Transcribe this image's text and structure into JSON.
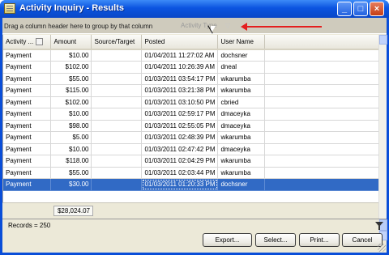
{
  "window": {
    "title": "Activity Inquiry - Results"
  },
  "group_panel": {
    "hint": "Drag a column header here to group by that column",
    "drag_ghost": "Activity Type"
  },
  "grid": {
    "columns": [
      "Activity ...",
      "Amount",
      "Source/Target",
      "Posted",
      "User Name"
    ],
    "rows": [
      {
        "activity": "Payment",
        "amount": "$10.00",
        "source": "",
        "posted": "01/04/2011 11:27:02 AM",
        "user": "dochsner"
      },
      {
        "activity": "Payment",
        "amount": "$102.00",
        "source": "",
        "posted": "01/04/2011 10:26:39 AM",
        "user": "dneal"
      },
      {
        "activity": "Payment",
        "amount": "$55.00",
        "source": "",
        "posted": "01/03/2011 03:54:17 PM",
        "user": "wkarumba"
      },
      {
        "activity": "Payment",
        "amount": "$115.00",
        "source": "",
        "posted": "01/03/2011 03:21:38 PM",
        "user": "wkarumba"
      },
      {
        "activity": "Payment",
        "amount": "$102.00",
        "source": "",
        "posted": "01/03/2011 03:10:50 PM",
        "user": "cbried"
      },
      {
        "activity": "Payment",
        "amount": "$10.00",
        "source": "",
        "posted": "01/03/2011 02:59:17 PM",
        "user": "dmaceyka"
      },
      {
        "activity": "Payment",
        "amount": "$98.00",
        "source": "",
        "posted": "01/03/2011 02:55:05 PM",
        "user": "dmaceyka"
      },
      {
        "activity": "Payment",
        "amount": "$5.00",
        "source": "",
        "posted": "01/03/2011 02:48:39 PM",
        "user": "wkarumba"
      },
      {
        "activity": "Payment",
        "amount": "$10.00",
        "source": "",
        "posted": "01/03/2011 02:47:42 PM",
        "user": "dmaceyka"
      },
      {
        "activity": "Payment",
        "amount": "$118.00",
        "source": "",
        "posted": "01/03/2011 02:04:29 PM",
        "user": "wkarumba"
      },
      {
        "activity": "Payment",
        "amount": "$55.00",
        "source": "",
        "posted": "01/03/2011 02:03:44 PM",
        "user": "wkarumba"
      },
      {
        "activity": "Payment",
        "amount": "$30.00",
        "source": "",
        "posted": "01/03/2011 01:20:33 PM",
        "user": "dochsner"
      }
    ],
    "selected_row": 11,
    "total": "$28,024.07"
  },
  "status": {
    "records": "Records = 250"
  },
  "buttons": {
    "export": "Export...",
    "select": "Select...",
    "print": "Print...",
    "cancel": "Cancel"
  },
  "icons": {
    "app": "document-list-icon",
    "filter": "funnel-icon",
    "minimize": "minimize-icon",
    "maximize": "maximize-icon",
    "close": "close-icon"
  },
  "colors": {
    "titlebar": "#0b54e0",
    "selection": "#316ac5",
    "annotation_arrow": "#e41f1f"
  }
}
